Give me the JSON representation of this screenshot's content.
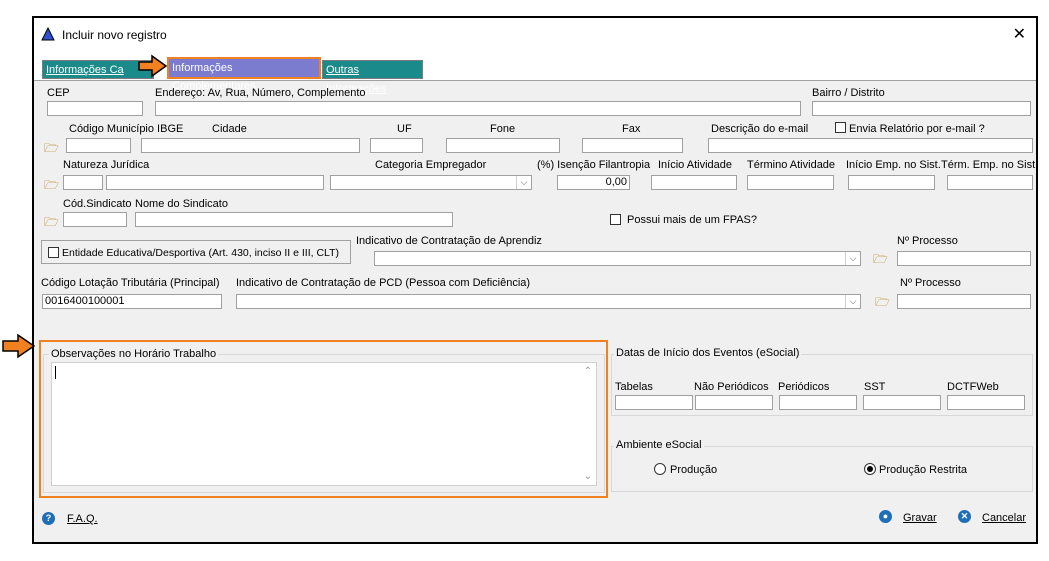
{
  "window": {
    "title": "Incluir novo registro"
  },
  "tabs": [
    {
      "label": "Informações Cadastrais",
      "visible_label": "Informações Ca"
    },
    {
      "label": "Informações Complementares"
    },
    {
      "label": "Outras Informações"
    }
  ],
  "row1": {
    "cep_label": "CEP",
    "endereco_label": "Endereço: Av, Rua, Número, Complemento",
    "bairro_label": "Bairro / Distrito"
  },
  "row2": {
    "codigo_municipio_label": "Código Município IBGE",
    "cidade_label": "Cidade",
    "uf_label": "UF",
    "fone_label": "Fone",
    "fax_label": "Fax",
    "email_label": "Descrição do e-mail",
    "envia_relatorio_label": "Envia Relatório por e-mail ?"
  },
  "row3": {
    "natureza_label": "Natureza Jurídica",
    "categoria_label": "Categoria Empregador",
    "isencao_label": "(%) Isenção Filantropia",
    "isencao_value": "0,00",
    "inicio_atividade_label": "Início Atividade",
    "termino_atividade_label": "Término Atividade",
    "inicio_emp_label": "Início Emp. no Sist.",
    "term_emp_label": "Térm. Emp. no Sist."
  },
  "row4": {
    "cod_sindicato_label": "Cód.Sindicato",
    "nome_sindicato_label": "Nome do Sindicato",
    "possui_fpas_label": "Possui mais de um FPAS?"
  },
  "row5": {
    "entidade_label": "Entidade Educativa/Desportiva (Art. 430, inciso II e III, CLT)",
    "aprendiz_label": "Indicativo de Contratação de Aprendiz",
    "processo_label": "Nº Processo"
  },
  "row6": {
    "lotacao_label": "Código Lotação Tributária (Principal)",
    "lotacao_value": "0016400100001",
    "pcd_label": "Indicativo de Contratação de PCD (Pessoa com Deficiência)",
    "processo_label": "Nº Processo"
  },
  "observacoes": {
    "title": "Observações no Horário Trabalho"
  },
  "datas": {
    "title": "Datas de Início dos Eventos (eSocial)",
    "columns": [
      "Tabelas",
      "Não Periódicos",
      "Periódicos",
      "SST",
      "DCTFWeb"
    ]
  },
  "ambiente": {
    "title": "Ambiente eSocial",
    "option_producao": "Produção",
    "option_restrita": "Produção Restrita",
    "selected": "Produção Restrita"
  },
  "footer": {
    "faq_label": "F.A.Q.",
    "gravar_label": "Gravar",
    "cancelar_label": "Cancelar"
  },
  "colors": {
    "tab_inactive": "#1a8a8a",
    "tab_active": "#7b7bd0",
    "highlight": "#f08020",
    "accent_blue": "#1e6fb8"
  }
}
